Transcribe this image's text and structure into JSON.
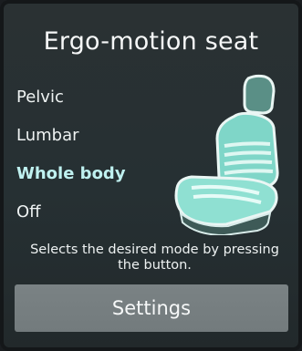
{
  "screen": {
    "title": "Ergo-motion seat",
    "modes": [
      {
        "label": "Pelvic",
        "selected": false
      },
      {
        "label": "Lumbar",
        "selected": false
      },
      {
        "label": "Whole body",
        "selected": true
      },
      {
        "label": "Off",
        "selected": false
      }
    ],
    "description": "Selects the desired mode by pressing the button.",
    "settings_label": "Settings",
    "seat_icon": "seat-massage-icon",
    "colors": {
      "background": "#283033",
      "selected_text": "#bff1f0",
      "seat_highlight": "#7fd6c8",
      "button": "#767e80"
    }
  }
}
